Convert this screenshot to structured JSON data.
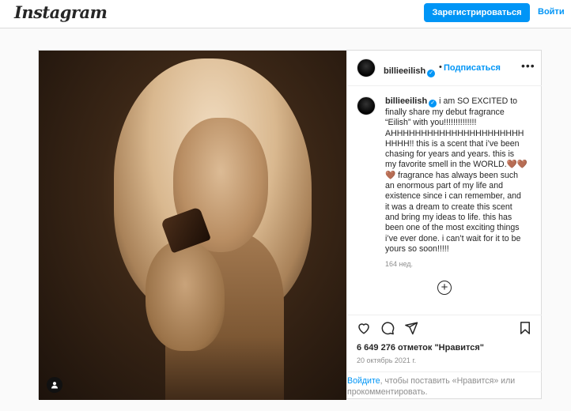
{
  "header": {
    "logo": "Instagram",
    "signup_label": "Зарегистрироваться",
    "login_label": "Войти"
  },
  "post": {
    "username": "billieeilish",
    "follow_label": "Подписаться",
    "more_icon": "more-horizontal-icon",
    "caption_lines": [
      "i am SO EXCITED to",
      "finally share my debut fragrance",
      "“Eilish” with you!!!!!!!!!!!!!!",
      "AHHHHHHHHHHHHHHHHHHHHHH",
      "HHHH!! this is a scent that i’ve been",
      "chasing for years and years. this is",
      "my favorite smell in the WORLD.🤎🤎",
      "🤎 fragrance has always been such",
      "an enormous part of my life and",
      "existence since i can remember, and",
      "it was a dream to create this scent",
      "and bring my ideas to life. this has",
      "been one of the most exciting things",
      "i’ve ever done. i can’t wait for it to be",
      "yours so soon!!!!!"
    ],
    "caption_time": "164 нед.",
    "likes": "6 649 276 отметок \"Нравится\"",
    "date": "20 октябрь 2021 г.",
    "login_link": "Войдите",
    "login_prompt_rest": ", чтобы поставить «Нравится» или прокомментировать."
  },
  "colors": {
    "accent": "#0095f6",
    "text": "#262626",
    "muted": "#8e8e8e",
    "border": "#dbdbdb"
  }
}
